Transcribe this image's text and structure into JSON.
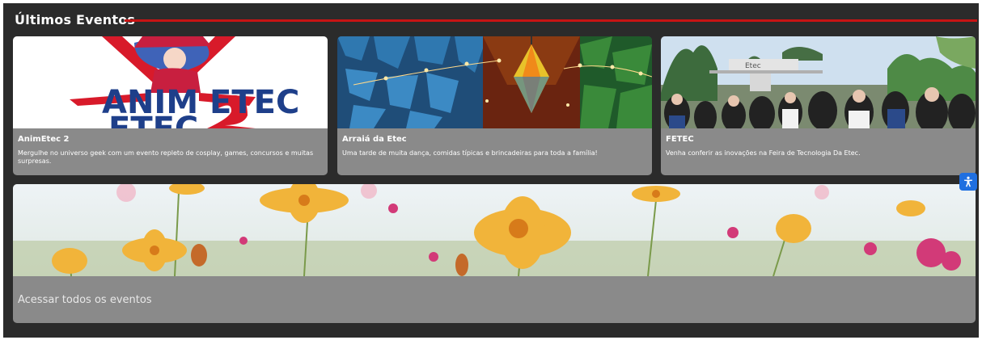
{
  "section": {
    "title": "Últimos Eventos"
  },
  "events": [
    {
      "title": "AnimEtec 2",
      "description": "Mergulhe no universo geek com um evento repleto de cosplay, games, concursos e muitas surpresas.",
      "image_text": "ANIM ETEC"
    },
    {
      "title": "Arraiá da Etec",
      "description": "Uma tarde de muita dança, comidas típicas e brincadeiras para toda a família!"
    },
    {
      "title": "FETEC",
      "description": "Venha conferir as inovações na Feira de Tecnologia Da Etec.",
      "image_text": "Etec"
    }
  ],
  "all_events": {
    "label": "Acessar todos os eventos"
  },
  "accessibility": {
    "icon": "accessibility-icon"
  },
  "colors": {
    "background": "#2b2b2b",
    "accent": "#c81414",
    "card": "#8a8a8a",
    "a11y": "#1f6fe0"
  }
}
